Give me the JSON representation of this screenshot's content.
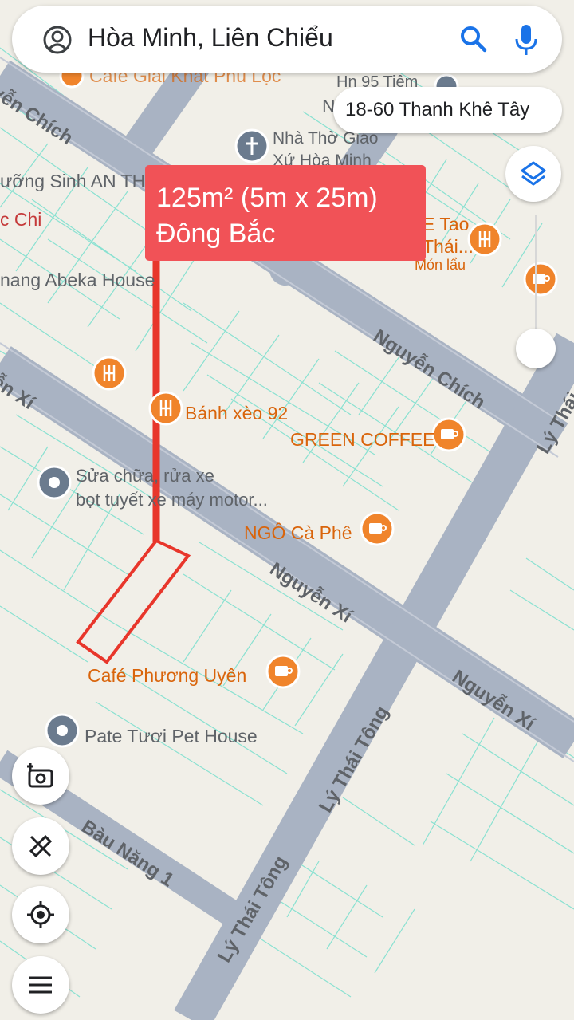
{
  "search": {
    "query": "Hòa Minh, Liên Chiểu"
  },
  "address_chip": "18-60 Thanh Khê Tây",
  "parcel": {
    "area": "125m² (5m x 25m)",
    "direction": "Đông Bắc"
  },
  "colors": {
    "parcel_outline": "#e8362b",
    "callout": "#f15257",
    "road": "#a9b3c3",
    "poi": "#d9640b",
    "accent": "#1a73e8"
  },
  "streets": {
    "nguyen_chich_left": "yễn Chích",
    "nguyen_chich_right": "Nguyễn Chích",
    "nguyen_xi_left": "ễn Xí",
    "nguyen_xi_mid": "Nguyễn Xí",
    "nguyen_xi_right": "Nguyễn Xí",
    "ly_thai_tong_right": "Lý Thái",
    "ly_thai_tong_mid": "Lý Thái Tông",
    "ly_thai_tong_bottom": "Lý Thái Tông",
    "bau_nang": "Bàu Năng 1"
  },
  "places": {
    "cafe_giai_khat": "Cafe Giải Khát Phú Lộc",
    "hn95": "Hn 95 Tiệm",
    "n_partial": "N",
    "church_l1": "Nhà Thờ Giáo",
    "church_l2": "Xứ Hòa Minh",
    "truong_sinh": "ưỡng Sinh AN TH",
    "c_chi": "c Chi",
    "abeka": "nang Abeka House",
    "tao_l1": "E Tao",
    "tao_l2": "Thái...",
    "mon_lau": "Món lẩu",
    "banh_xeo": "Bánh xèo 92",
    "green_coffee": "GREEN COFFEE",
    "sua_chua_l1": "Sửa chữa, rửa xe",
    "sua_chua_l2": "bọt tuyết xe máy motor...",
    "ngo_ca_phe": "NGÔ Cà Phê",
    "cafe_phuong_uyen": "Café Phương Uyên",
    "pate_tuoi": "Pate Tươi Pet House"
  },
  "icons": {
    "account": "account-circle-icon",
    "search": "search-icon",
    "mic": "mic-icon",
    "layers": "layers-icon",
    "add_photo": "add-photo-icon",
    "measure": "measure-icon",
    "location": "my-location-icon",
    "menu": "menu-icon"
  }
}
